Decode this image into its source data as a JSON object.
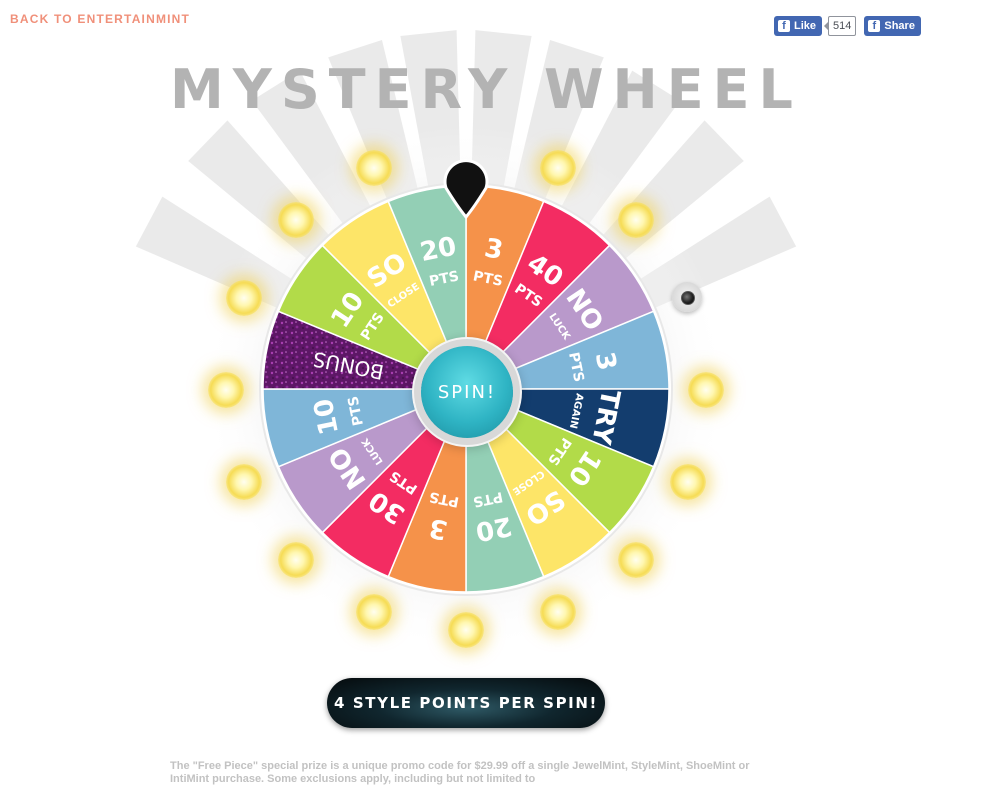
{
  "nav": {
    "back_link": "BACK TO ENTERTAINMINT"
  },
  "social": {
    "like_label": "Like",
    "like_count": "514",
    "share_label": "Share",
    "brand_color": "#4267b2"
  },
  "title": "MYSTERY WHEEL",
  "wheel": {
    "segments": [
      {
        "main": "3",
        "sub": "PTS",
        "color": "#f5924a",
        "variant": "pts"
      },
      {
        "main": "40",
        "sub": "PTS",
        "color": "#f32c62",
        "variant": "pts"
      },
      {
        "main": "NO",
        "sub": "LUCK",
        "color": "#b999cb",
        "variant": "pts"
      },
      {
        "main": "3",
        "sub": "PTS",
        "color": "#7fb6d8",
        "variant": "pts"
      },
      {
        "main": "TRY",
        "sub": "AGAIN",
        "color": "#133d6e",
        "variant": "pts"
      },
      {
        "main": "10",
        "sub": "PTS",
        "color": "#b2db49",
        "variant": "pts"
      },
      {
        "main": "SO",
        "sub": "CLOSE",
        "color": "#fde568",
        "variant": "pts"
      },
      {
        "main": "20",
        "sub": "PTS",
        "color": "#93cfb5",
        "variant": "pts"
      },
      {
        "main": "3",
        "sub": "PTS",
        "color": "#f5924a",
        "variant": "pts"
      },
      {
        "main": "30",
        "sub": "PTS",
        "color": "#f32c62",
        "variant": "pts"
      },
      {
        "main": "NO",
        "sub": "LUCK",
        "color": "#b999cb",
        "variant": "pts"
      },
      {
        "main": "10",
        "sub": "PTS",
        "color": "#7fb6d8",
        "variant": "pts"
      },
      {
        "main": "BONUS",
        "sub": "",
        "color": "#6a1a70",
        "variant": "bonus"
      },
      {
        "main": "10",
        "sub": "PTS",
        "color": "#b2db49",
        "variant": "pts"
      },
      {
        "main": "SO",
        "sub": "CLOSE",
        "color": "#fde568",
        "variant": "pts"
      },
      {
        "main": "20",
        "sub": "PTS",
        "color": "#93cfb5",
        "variant": "pts"
      }
    ],
    "spin_label": "SPIN!",
    "pointer_icon": "map-pin-icon"
  },
  "banner": "4 STYLE POINTS PER SPIN!",
  "footer": "The \"Free Piece\" special prize is a unique promo code for $29.99 off a single JewelMint, StyleMint, ShoeMint or IntiMint purchase. Some exclusions apply, including but not limited to"
}
